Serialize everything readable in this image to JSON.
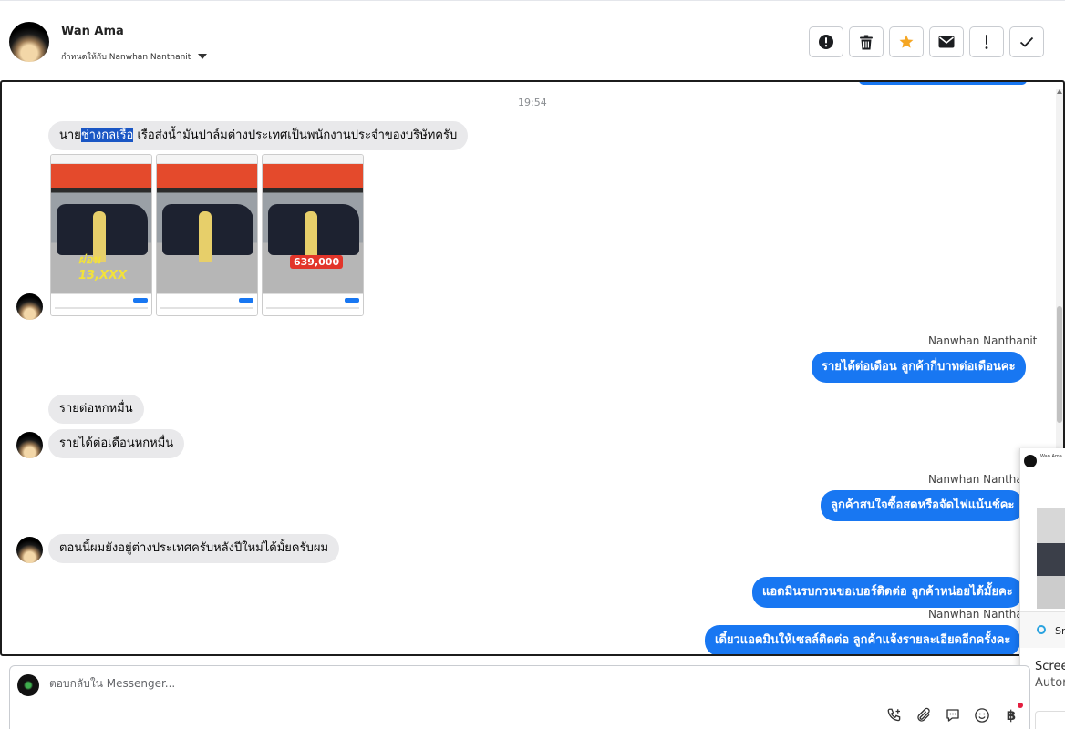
{
  "header": {
    "contact_name": "Wan Ama",
    "assigned_to": "กำหนดให้กับ Nanwhan Nanthanit"
  },
  "actions": [
    {
      "name": "spam-button",
      "icon": "alert-circle-icon"
    },
    {
      "name": "delete-button",
      "icon": "trash-icon"
    },
    {
      "name": "star-button",
      "icon": "star-icon",
      "color": "#f5a623"
    },
    {
      "name": "mark-unread-button",
      "icon": "envelope-icon"
    },
    {
      "name": "follow-up-button",
      "icon": "exclamation-icon"
    },
    {
      "name": "done-button",
      "icon": "checkmark-icon"
    }
  ],
  "conversation": {
    "timestamp": "19:54",
    "msg1": {
      "pre": "นาย",
      "highlight": "ช่างกลเรือ",
      "post": " เรือส่งน้ำมันปาล์มต่างประเทศเป็นพนักงานประจำของบริษัทครับ"
    },
    "images": [
      {
        "promo": "ผ่อน 13,XXX",
        "price": ""
      },
      {
        "promo": "",
        "price": ""
      },
      {
        "promo": "",
        "price": "639,000"
      }
    ],
    "sender_1": "Nanwhan Nanthanit",
    "msg2": "รายได้ต่อเดือน ลูกค้ากี่บาทต่อเดือนคะ",
    "msg3": "รายต่อหกหมื่น",
    "msg4": "รายได้ต่อเดือนหกหมื่น",
    "sender_2": "Nanwhan Nanthan",
    "msg5": "ลูกค้าสนใจซื้อสดหรือจัดไฟแน้นช์คะ",
    "msg6": "ตอนนี้ผมยังอยู่ต่างประเทศครับหลังปีใหม่ได้มั้ยครับผม",
    "msg7": "แอดมินรบกวนขอเบอร์ติดต่อ ลูกค้าหน่อยได้มั้ยคะ",
    "sender_3": "Nanwhan Nanthan",
    "msg8": "เดี๋ยวแอดมินให้เซลล์ติดต่อ ลูกค้าแจ้งรายละเอียดอีกครั้งคะ"
  },
  "popup": {
    "name": "Wan Ama",
    "snip_label": "Sn",
    "title": "Scree",
    "subtitle": "Autor"
  },
  "reply": {
    "placeholder": "ตอบกลับใน Messenger...",
    "baht_symbol": "฿"
  },
  "colors": {
    "accent": "#1877f2",
    "incoming_bubble": "#e9e9eb",
    "star": "#f5a623"
  }
}
